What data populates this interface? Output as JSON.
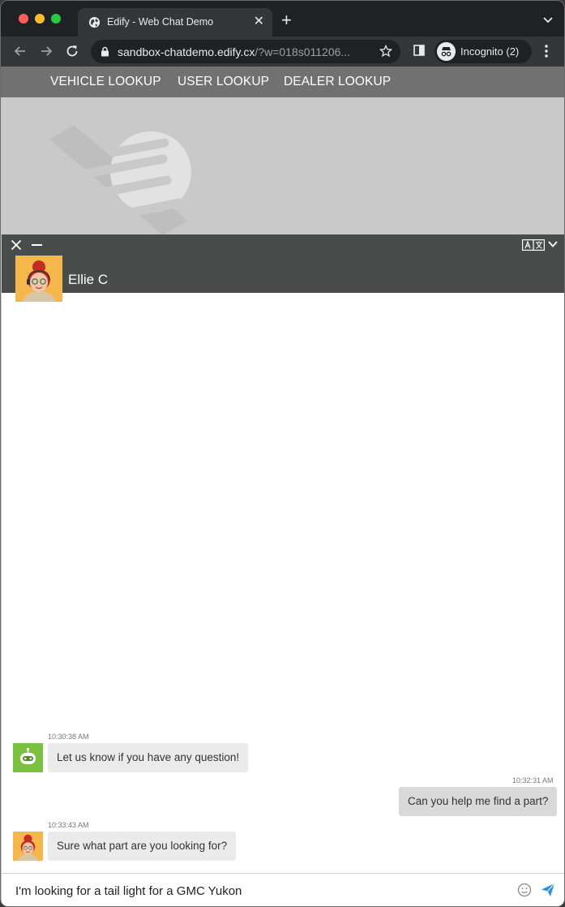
{
  "browser": {
    "tab_title": "Edify - Web Chat Demo",
    "url_host": "sandbox-chatdemo.edify.cx",
    "url_rest": "/?w=018s011206...",
    "profile_label": "Incognito (2)"
  },
  "site_nav": {
    "items": [
      {
        "label": "VEHICLE LOOKUP"
      },
      {
        "label": "USER LOOKUP"
      },
      {
        "label": "DEALER LOOKUP"
      }
    ]
  },
  "chat": {
    "agent_name": "Ellie C",
    "messages": [
      {
        "sender": "bot",
        "time": "10:30:38 AM",
        "text": "Let us know if you have any question!"
      },
      {
        "sender": "user",
        "time": "10:32:31 AM",
        "text": "Can you help me find a part?"
      },
      {
        "sender": "agent",
        "time": "10:33:43 AM",
        "text": "Sure what part are you looking for?"
      }
    ],
    "composer_value": "I'm looking for a tail light for a GMC Yukon"
  },
  "colors": {
    "chat_header": "#4a4b4b",
    "site_nav": "#717171",
    "bot_avatar": "#7ac142",
    "agent_avatar": "#f5b64c",
    "send_icon": "#2d8fd5"
  }
}
